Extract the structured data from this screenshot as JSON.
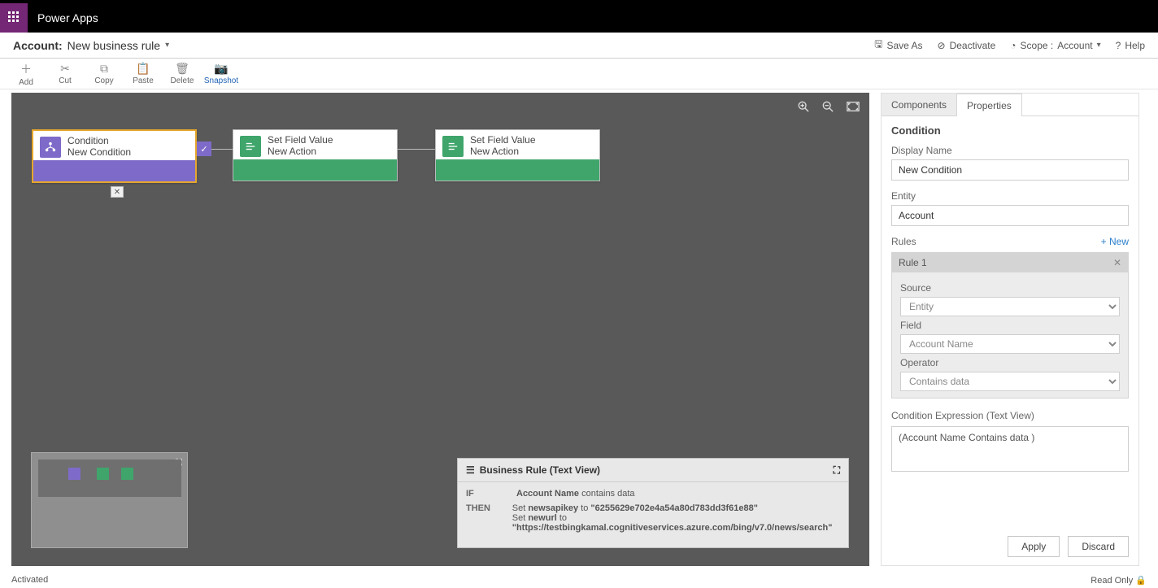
{
  "header": {
    "app_title": "Power Apps"
  },
  "entitybar": {
    "prefix": "Account:",
    "name": "New business rule",
    "actions": {
      "saveas": "Save As",
      "deactivate": "Deactivate",
      "scope_label": "Scope :",
      "scope_value": "Account",
      "help": "Help"
    }
  },
  "toolbar": {
    "add": "Add",
    "cut": "Cut",
    "copy": "Copy",
    "paste": "Paste",
    "delete": "Delete",
    "snapshot": "Snapshot"
  },
  "canvas": {
    "nodes": {
      "cond": {
        "title": "Condition",
        "subtitle": "New Condition"
      },
      "act1": {
        "title": "Set Field Value",
        "subtitle": "New Action"
      },
      "act2": {
        "title": "Set Field Value",
        "subtitle": "New Action"
      }
    }
  },
  "textview": {
    "title": "Business Rule (Text View)",
    "if": "IF",
    "then": "THEN",
    "cond_field": "Account Name",
    "cond_rest": " contains data",
    "set1_pre": "Set ",
    "set1_f": "newsapikey",
    "set1_mid": " to ",
    "set1_v": "\"6255629e702e4a54a80d783dd3f61e88\"",
    "set2_pre": "Set ",
    "set2_f": "newurl",
    "set2_mid": " to ",
    "set2_v": "\"https://testbingkamal.cognitiveservices.azure.com/bing/v7.0/news/search\""
  },
  "side": {
    "tabs": {
      "components": "Components",
      "properties": "Properties"
    },
    "section": "Condition",
    "display_name_label": "Display Name",
    "display_name_value": "New Condition",
    "entity_label": "Entity",
    "entity_value": "Account",
    "rules_label": "Rules",
    "new_label": "+ New",
    "rule_title": "Rule 1",
    "source_label": "Source",
    "source_value": "Entity",
    "field_label": "Field",
    "field_value": "Account Name",
    "operator_label": "Operator",
    "operator_value": "Contains data",
    "expr_label": "Condition Expression (Text View)",
    "expr_value": "(Account Name Contains data )",
    "apply": "Apply",
    "discard": "Discard"
  },
  "status": {
    "left": "Activated",
    "right": "Read Only 🔒"
  }
}
